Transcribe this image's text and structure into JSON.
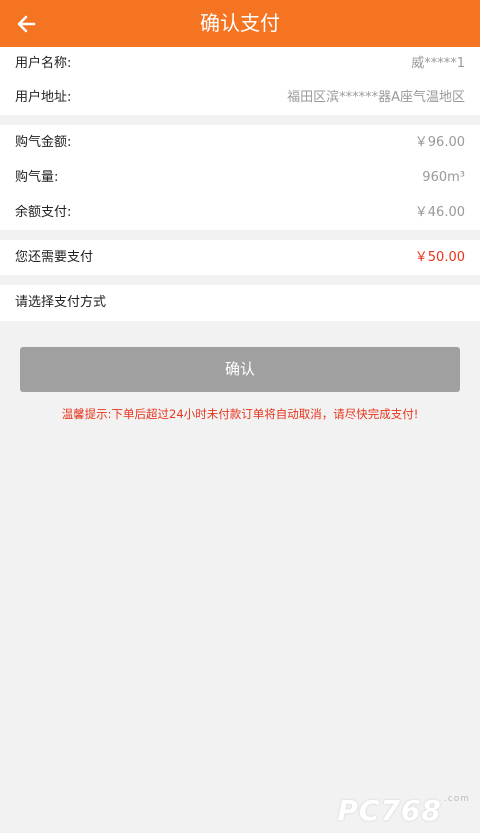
{
  "header": {
    "title": "确认支付",
    "back_icon": "arrow-left-icon",
    "color": "#f47422"
  },
  "user": {
    "name_label": "用户名称:",
    "name_value": "威*****1",
    "address_label": "用户地址:",
    "address_value": "福田区滨******器A座气温地区"
  },
  "purchase": {
    "amount_label": "购气金额:",
    "amount_value": "￥96.00",
    "volume_label": "购气量:",
    "volume_value": "960m³",
    "balance_label": "余额支付:",
    "balance_value": "￥46.00"
  },
  "due": {
    "label": "您还需要支付",
    "value": "￥50.00",
    "color": "#e8341c"
  },
  "payment": {
    "label": "请选择支付方式"
  },
  "confirm": {
    "label": "确认"
  },
  "tip": {
    "text": "温馨提示:下单后超过24小时未付款订单将自动取消，请尽快完成支付!"
  },
  "watermark": {
    "text": "PC768",
    "suffix": ".com"
  }
}
